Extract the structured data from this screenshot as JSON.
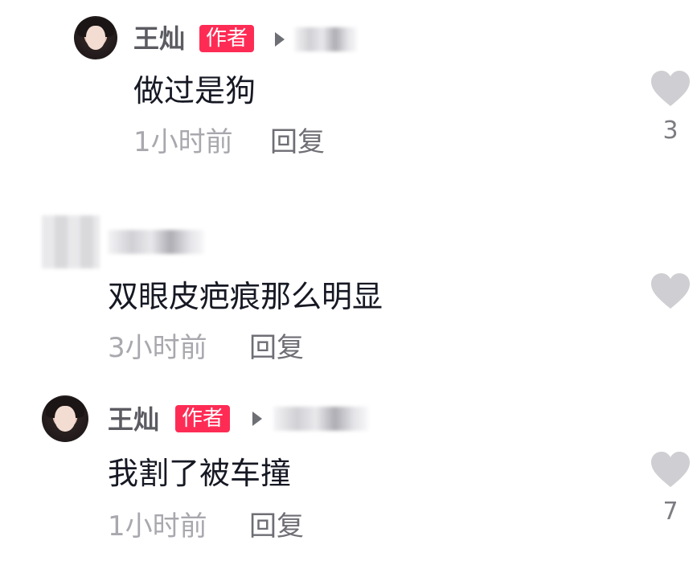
{
  "comments": [
    {
      "author": "王灿",
      "badge": "作者",
      "text": "做过是狗",
      "time": "1小时前",
      "reply_label": "回复",
      "like_count": "3",
      "icon": "heart-icon"
    },
    {
      "author": "",
      "badge": "",
      "text": "双眼皮疤痕那么明显",
      "time": "3小时前",
      "reply_label": "回复",
      "like_count": "",
      "icon": "heart-icon"
    },
    {
      "author": "王灿",
      "badge": "作者",
      "text": "我割了被车撞",
      "time": "1小时前",
      "reply_label": "回复",
      "like_count": "7",
      "icon": "heart-icon"
    }
  ],
  "colors": {
    "badge": "#fe2c55",
    "heart": "#cfcfd3",
    "meta": "#a8a8ae"
  }
}
